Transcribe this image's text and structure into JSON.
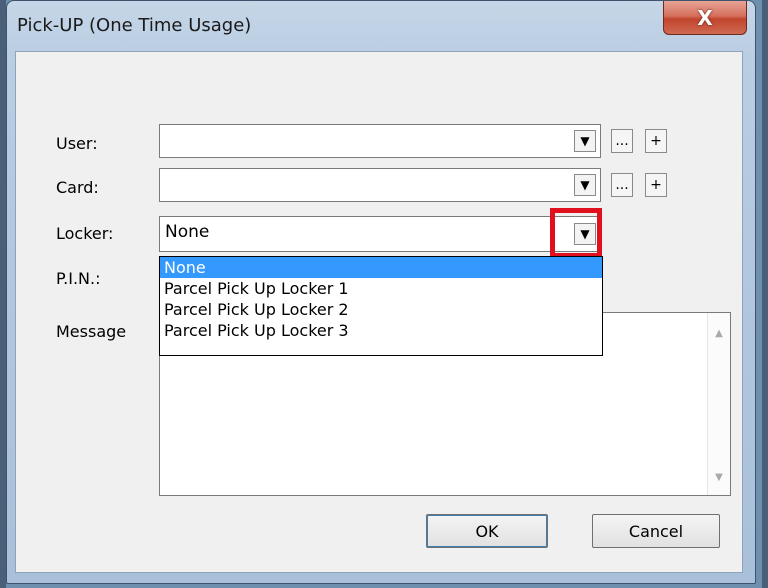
{
  "window": {
    "title": "Pick-UP (One Time Usage)",
    "close_label": "X"
  },
  "form": {
    "user_label": "User:",
    "card_label": "Card:",
    "locker_label": "Locker:",
    "pin_label": "P.I.N.:",
    "message_label": "Message",
    "user_value": "",
    "card_value": "",
    "locker_value": "None",
    "ellipsis_label": "...",
    "plus_label": "+"
  },
  "locker_dropdown": {
    "options": [
      "None",
      "Parcel Pick Up Locker 1",
      "Parcel Pick Up Locker 2",
      "Parcel Pick Up Locker 3"
    ],
    "selected": "None"
  },
  "buttons": {
    "ok": "OK",
    "cancel": "Cancel"
  },
  "colors": {
    "highlight": "#e0101e",
    "selection": "#3399ff"
  }
}
